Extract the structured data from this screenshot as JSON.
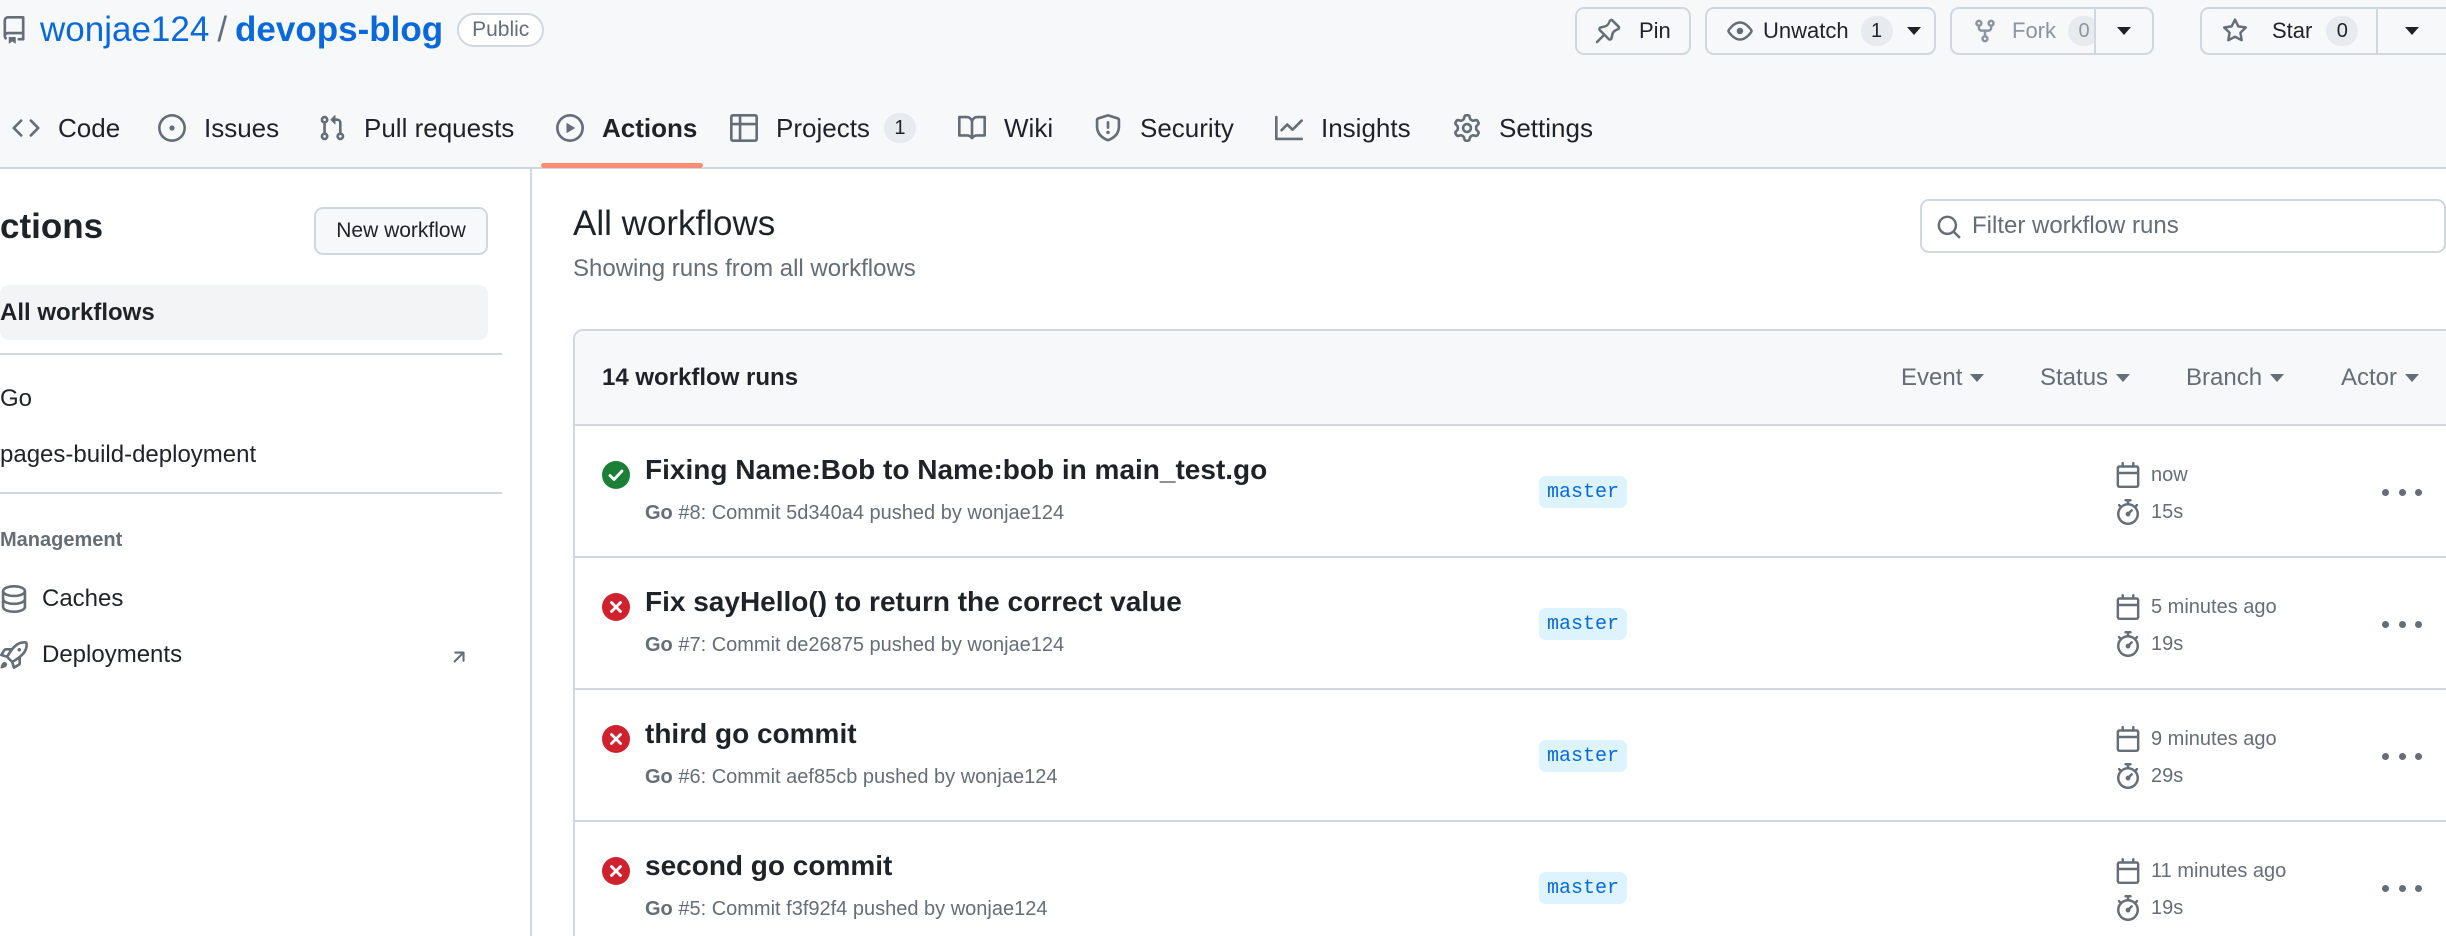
{
  "repo": {
    "owner": "wonjae124",
    "separator": "/",
    "name": "devops-blog",
    "visibility": "Public"
  },
  "header_buttons": {
    "pin": "Pin",
    "unwatch": "Unwatch",
    "unwatch_count": "1",
    "fork": "Fork",
    "fork_count": "0",
    "star": "Star",
    "star_count": "0"
  },
  "tabs": [
    {
      "label": "Code",
      "icon": "code-icon"
    },
    {
      "label": "Issues",
      "icon": "issue-icon"
    },
    {
      "label": "Pull requests",
      "icon": "pull-request-icon"
    },
    {
      "label": "Actions",
      "icon": "play-icon",
      "active": true
    },
    {
      "label": "Projects",
      "icon": "table-icon",
      "count": "1"
    },
    {
      "label": "Wiki",
      "icon": "book-icon"
    },
    {
      "label": "Security",
      "icon": "shield-icon"
    },
    {
      "label": "Insights",
      "icon": "graph-icon"
    },
    {
      "label": "Settings",
      "icon": "gear-icon"
    }
  ],
  "sidebar": {
    "title": "ctions",
    "new_workflow": "New workflow",
    "all_workflows": "All workflows",
    "workflows": [
      "Go",
      "pages-build-deployment"
    ],
    "management_heading": "Management",
    "management_items": [
      {
        "label": "Caches",
        "icon": "database-icon"
      },
      {
        "label": "Deployments",
        "icon": "rocket-icon",
        "external": true
      }
    ]
  },
  "main": {
    "title": "All workflows",
    "subtitle": "Showing runs from all workflows",
    "filter_placeholder": "Filter workflow runs",
    "runs_count": "14 workflow runs",
    "filters": [
      "Event",
      "Status",
      "Branch",
      "Actor"
    ]
  },
  "runs": [
    {
      "status": "success",
      "title": "Fixing Name:Bob to Name:bob in main_test.go",
      "workflow": "Go",
      "meta": " #8: Commit 5d340a4 pushed by wonjae124",
      "branch": "master",
      "when": "now",
      "duration": "15s"
    },
    {
      "status": "failure",
      "title": "Fix sayHello() to return the correct value",
      "workflow": "Go",
      "meta": " #7: Commit de26875 pushed by wonjae124",
      "branch": "master",
      "when": "5 minutes ago",
      "duration": "19s"
    },
    {
      "status": "failure",
      "title": "third go commit",
      "workflow": "Go",
      "meta": " #6: Commit aef85cb pushed by wonjae124",
      "branch": "master",
      "when": "9 minutes ago",
      "duration": "29s"
    },
    {
      "status": "failure",
      "title": "second go commit",
      "workflow": "Go",
      "meta": " #5: Commit f3f92f4 pushed by wonjae124",
      "branch": "master",
      "when": "11 minutes ago",
      "duration": "19s"
    }
  ],
  "colors": {
    "link": "#0969da",
    "success": "#1a7f37",
    "failure": "#cf222e",
    "active_tab_underline": "#fd8c73",
    "branch_badge_bg": "#ddf4ff"
  }
}
